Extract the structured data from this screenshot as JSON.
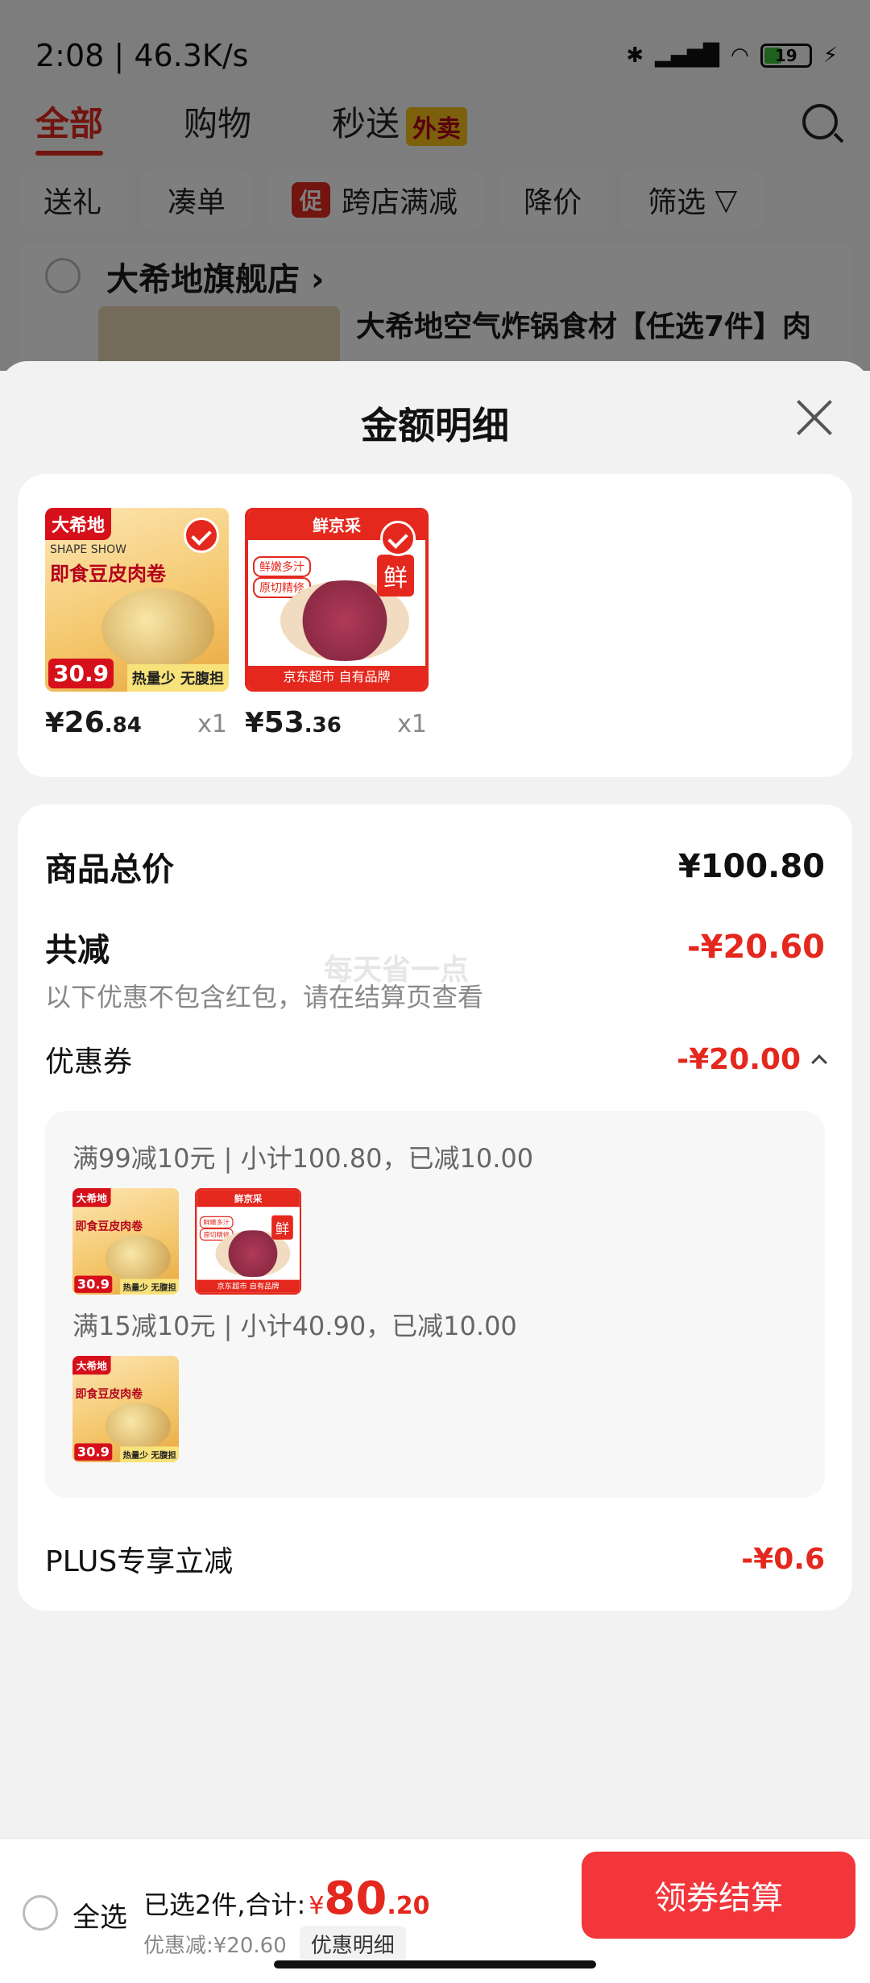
{
  "status_bar": {
    "time": "2:08",
    "speed": "46.3K/s",
    "battery": "19"
  },
  "background": {
    "tabs": [
      {
        "label": "全部"
      },
      {
        "label": "购物"
      },
      {
        "label": "秒送"
      }
    ],
    "tab_badge": "外卖",
    "chips": [
      "送礼",
      "凑单",
      "跨店满减",
      "降价",
      "筛选"
    ],
    "chip_promo_badge": "促",
    "shop_name": "大希地旗舰店",
    "product_name": "大希地空气炸锅食材【任选7件】肉"
  },
  "sheet": {
    "title": "金额明细",
    "products": [
      {
        "price_yen": "¥",
        "price_int": "26",
        "price_dec": ".84",
        "qty": "x1",
        "img": {
          "brand": "大希地",
          "line1": "SHAPE SHOW",
          "line2": "即食豆皮肉卷",
          "price": "30.9",
          "foot": "热量少 无腹担"
        }
      },
      {
        "price_yen": "¥",
        "price_int": "53",
        "price_dec": ".36",
        "qty": "x1",
        "img": {
          "brand": "鲜京采",
          "tag1": "鲜嫩多汁",
          "tag2": "原切精修",
          "badge": "鲜",
          "foot": "京东超市 自有品牌"
        }
      }
    ],
    "total_label": "商品总价",
    "total_value": "¥100.80",
    "reduce_label": "共减",
    "reduce_value": "-¥20.60",
    "reduce_note": "以下优惠不包含红包，请在结算页查看",
    "watermark": "每天省一点",
    "coupon_label": "优惠券",
    "coupon_value": "-¥20.00",
    "coupon_details": [
      "满99减10元 | 小计100.80，已减10.00",
      "满15减10元 | 小计40.90，已减10.00"
    ],
    "plus_label": "PLUS专享立减",
    "plus_value": "-¥0.6"
  },
  "bottom_bar": {
    "select_all": "全选",
    "selected_text": "已选2件,合计:",
    "currency": "¥",
    "total_int": "80",
    "total_dec": ".20",
    "discount_text": "优惠减:¥20.60",
    "detail_button": "优惠明细",
    "checkout_button": "领券结算"
  },
  "colors": {
    "accent": "#e4281e",
    "checkout": "#f2363b"
  }
}
